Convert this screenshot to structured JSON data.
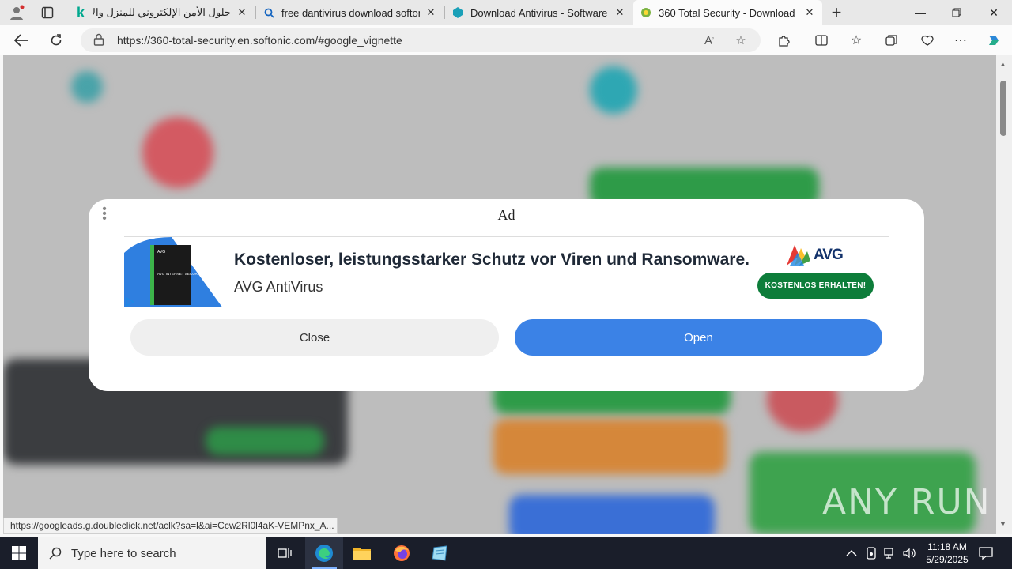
{
  "browser": {
    "tabs": [
      {
        "title": "حلول الأمن الإلكتروني للمنزل والأعمال",
        "icon": "kaspersky-k-icon"
      },
      {
        "title": "free dantivirus download softonic",
        "icon": "search-icon"
      },
      {
        "title": "Download Antivirus - Software for",
        "icon": "softonic-icon"
      },
      {
        "title": "360 Total Security - Download",
        "icon": "360-total-security-icon",
        "active": true
      }
    ],
    "url": "https://360-total-security.en.softonic.com/#google_vignette",
    "status_url": "https://googleads.g.doubleclick.net/aclk?sa=l&ai=Ccw2Rl0l4aK-VEMPnx_A..."
  },
  "ad_dialog": {
    "title": "Ad",
    "banner": {
      "headline": "Kostenloser, leistungsstarker Schutz vor Viren und Ransomware.",
      "product": "AVG AntiVirus",
      "brand": "AVG",
      "box_text": "AVG INTERNET SECURITY",
      "cta": "KOSTENLOS ERHALTEN!"
    },
    "close_label": "Close",
    "open_label": "Open"
  },
  "watermark": "ANY RUN",
  "taskbar": {
    "search_placeholder": "Type here to search",
    "time": "11:18 AM",
    "date": "5/29/2025"
  },
  "colors": {
    "open_button": "#3b82e6",
    "cta_green": "#0d7d3a",
    "taskbar": "#1a1e2a"
  }
}
